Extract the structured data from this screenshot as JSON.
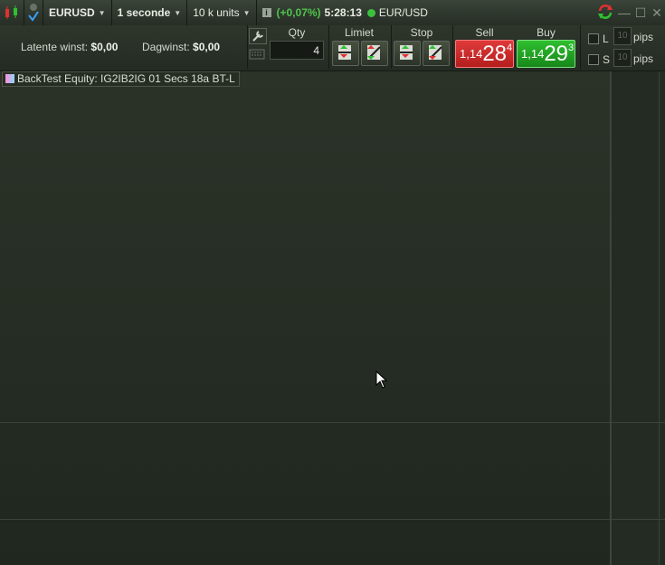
{
  "toolbar": {
    "symbol": "EURUSD",
    "timeframe": "1 seconde",
    "units": "10 k units",
    "change": "(+0,07%)",
    "time": "5:28:13",
    "instrument": "EUR/USD",
    "icons": [
      "candlestick-icon",
      "check-icon",
      "info-icon",
      "refresh-icon",
      "minimize-icon",
      "maximize-icon",
      "close-icon"
    ]
  },
  "panel": {
    "latent_label": "Latente winst:",
    "latent_value": "$0,00",
    "day_label": "Dagwinst:",
    "day_value": "$0,00",
    "qty_label": "Qty",
    "qty_value": "4",
    "limit_label": "Limiet",
    "stop_label": "Stop",
    "sell_label": "Sell",
    "buy_label": "Buy",
    "sell_price": {
      "pre": "1,14",
      "big": "28",
      "sup": "4"
    },
    "buy_price": {
      "pre": "1,14",
      "big": "29",
      "sup": "3"
    },
    "l_label": "L",
    "s_label": "S",
    "pips_value_1": "10",
    "pips_value_2": "10",
    "pips_unit": "pips",
    "colors": {
      "sell": "#d42e2e",
      "buy": "#22a822"
    }
  },
  "chart": {
    "legend": "BackTest Equity: IG2IB2IG 01 Secs 18a BT-L"
  }
}
